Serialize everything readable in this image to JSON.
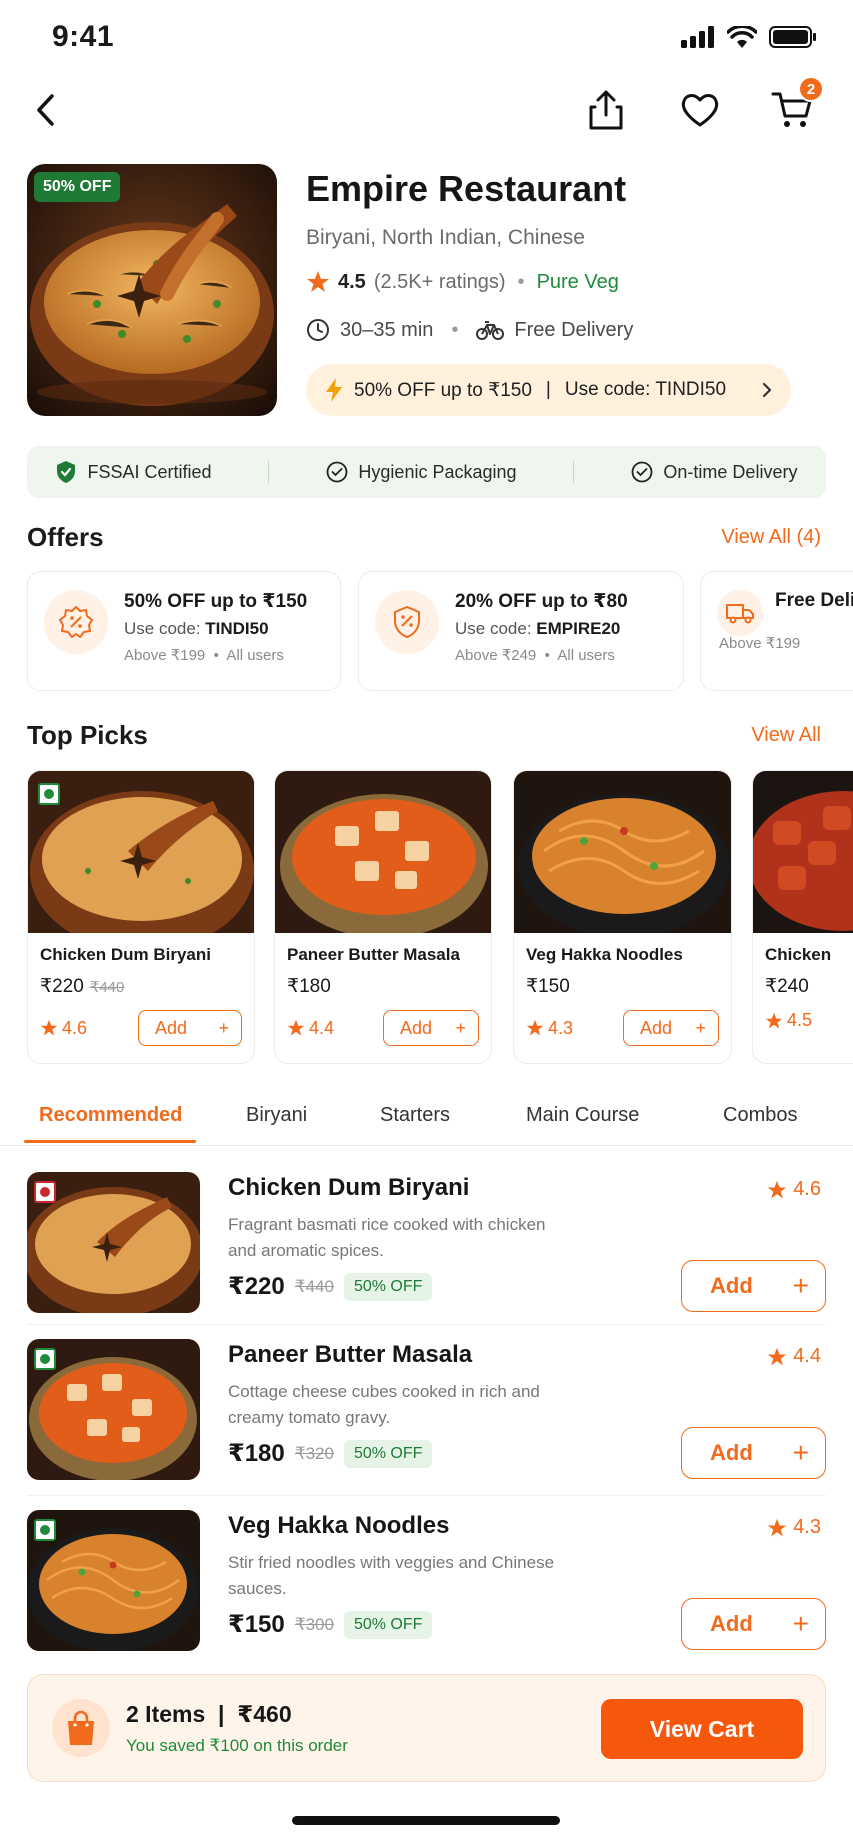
{
  "status": {
    "time": "9:41"
  },
  "cart_badge": "2",
  "restaurant": {
    "discount_tag": "50% OFF",
    "name": "Empire Restaurant",
    "cuisine": "Biryani, North Indian, Chinese",
    "rating": "4.5",
    "ratings_count": "(2.5K+ ratings)",
    "veg_label": "Pure Veg",
    "delivery_time": "30–35 min",
    "delivery_fee": "Free Delivery",
    "promo_text": "50% OFF up to ₹150",
    "promo_code_text": "Use code: TINDI50"
  },
  "trust": [
    "FSSAI Certified",
    "Hygienic Packaging",
    "On-time Delivery"
  ],
  "offers": {
    "title": "Offers",
    "view_all": "View All (4)",
    "items": [
      {
        "title": "50% OFF up to ₹150",
        "code_label": "Use code: ",
        "code": "TINDI50",
        "min": "Above ₹199",
        "users": "All users"
      },
      {
        "title": "20% OFF up to ₹80",
        "code_label": "Use code: ",
        "code": "EMPIRE20",
        "min": "Above ₹249",
        "users": "All users"
      },
      {
        "title": "Free Deli",
        "min": "Above ₹199"
      }
    ]
  },
  "top_picks": {
    "title": "Top Picks",
    "view_all": "View All",
    "add_label": "Add",
    "items": [
      {
        "name": "Chicken Dum Biryani",
        "price": "₹220",
        "old_price": "₹440",
        "rating": "4.6"
      },
      {
        "name": "Paneer Butter Masala",
        "price": "₹180",
        "rating": "4.4"
      },
      {
        "name": "Veg Hakka Noodles",
        "price": "₹150",
        "rating": "4.3"
      },
      {
        "name": "Chicken",
        "price": "₹240",
        "rating": "4.5"
      }
    ]
  },
  "tabs": [
    "Recommended",
    "Biryani",
    "Starters",
    "Main Course",
    "Combos"
  ],
  "menu": {
    "add_label": "Add",
    "items": [
      {
        "name": "Chicken Dum Biryani",
        "desc": "Fragrant basmati rice cooked with chicken and aromatic spices.",
        "price": "₹220",
        "old_price": "₹440",
        "discount": "50% OFF",
        "rating": "4.6"
      },
      {
        "name": "Paneer Butter Masala",
        "desc": "Cottage cheese cubes cooked in rich and creamy tomato gravy.",
        "price": "₹180",
        "old_price": "₹320",
        "discount": "50% OFF",
        "rating": "4.4"
      },
      {
        "name": "Veg Hakka Noodles",
        "desc": "Stir fried noodles with veggies and Chinese sauces.",
        "price": "₹150",
        "old_price": "₹300",
        "discount": "50% OFF",
        "rating": "4.3"
      }
    ]
  },
  "cart": {
    "summary": "2 Items  |  ₹460",
    "saved": "You saved ₹100 on this order",
    "button": "View Cart"
  },
  "colors": {
    "accent": "#f26a1b",
    "veg": "#1f8a3a",
    "nonveg": "#c8272f"
  }
}
